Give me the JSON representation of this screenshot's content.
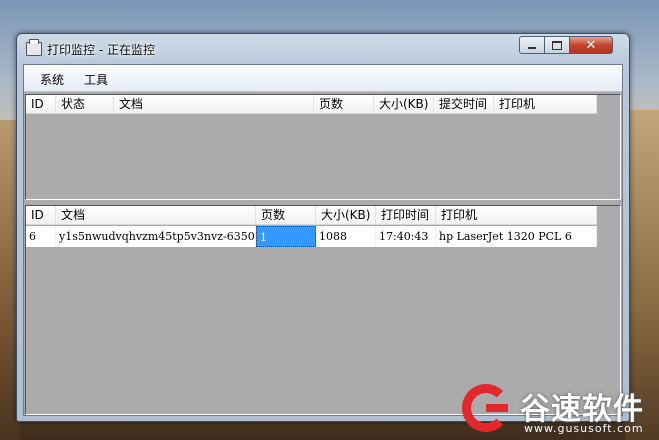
{
  "window": {
    "title": "打印监控 - 正在监控"
  },
  "menu": {
    "items": [
      "系统",
      "工具"
    ]
  },
  "queue_list": {
    "columns": [
      "ID",
      "状态",
      "文档",
      "页数",
      "大小(KB)",
      "提交时间",
      "打印机"
    ],
    "rows": []
  },
  "history_list": {
    "columns": [
      "ID",
      "文档",
      "页数",
      "大小(KB)",
      "打印时间",
      "打印机"
    ],
    "rows": [
      {
        "id": "6",
        "document": "y1s5nwudvqhvzm45tp5v3nvz-6350...",
        "pages": "1",
        "size": "1088",
        "time": "17:40:43",
        "printer": "hp LaserJet 1320 PCL 6"
      }
    ]
  },
  "watermark": {
    "text": "谷速软件",
    "url": "www.gususoft.com"
  },
  "colors": {
    "selection": "#3399ff",
    "close_button": "#c7452e",
    "watermark_red": "#e2272d"
  },
  "icons": {
    "app": "printer-icon",
    "minimize": "minimize-icon",
    "maximize": "maximize-icon",
    "close": "close-icon"
  }
}
